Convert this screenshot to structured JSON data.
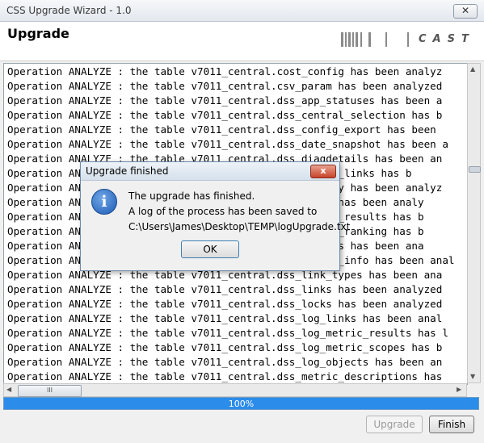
{
  "window": {
    "title": "CSS Upgrade Wizard - 1.0",
    "close_glyph": "✕"
  },
  "header": {
    "heading": "Upgrade",
    "logo_text": "CAST"
  },
  "log": {
    "lines": [
      "Operation ANALYZE : the table v7011_central.cost_config has been analyz",
      "Operation ANALYZE : the table v7011_central.csv_param has been analyzed",
      "Operation ANALYZE : the table v7011_central.dss_app_statuses has been a",
      "Operation ANALYZE : the table v7011_central.dss_central_selection has b",
      "Operation ANALYZE : the table v7011_central.dss_config_export has been",
      "Operation ANALYZE : the table v7011_central.dss_date_snapshot has been a",
      "Operation ANALYZE : the table v7011_central.dss_diagdetails has been an",
      "Operation ANALYZE : the table v7011_central.dss_module_links has b",
      "Operation ANALYZE : the table v7011_central.dss_history has been analyz",
      "Operation ANALYZE : the table v7011_central.dss_links has been analy",
      "Operation ANALYZE : the table v7011_central.dss_metric_results has b",
      "Operation ANALYZE : the table v7011_central.dss_object_ranking has b",
      "Operation ANALYZE : the table v7011_central.dss_objects has been ana",
      "Operation ANALYZE : the table v7011_central.dss_object_info has been anal",
      "Operation ANALYZE : the table v7011_central.dss_link_types has been ana",
      "Operation ANALYZE : the table v7011_central.dss_links has been analyzed",
      "Operation ANALYZE : the table v7011_central.dss_locks has been analyzed",
      "Operation ANALYZE : the table v7011_central.dss_log_links has been anal",
      "Operation ANALYZE : the table v7011_central.dss_log_metric_results has l",
      "Operation ANALYZE : the table v7011_central.dss_log_metric_scopes has b",
      "Operation ANALYZE : the table v7011_central.dss_log_objects has been an",
      "Operation ANALYZE : the table v7011_central.dss_metric_descriptions has"
    ]
  },
  "scrollbars": {
    "horizontal_thumb_grip": "III",
    "left_arrow": "◀",
    "right_arrow": "▶",
    "up_arrow": "▲",
    "down_arrow": "▼"
  },
  "progress": {
    "value_percent": 100,
    "label": "100%",
    "color": "#2b8cea"
  },
  "buttons": {
    "upgrade_label": "Upgrade",
    "finish_label": "Finish"
  },
  "dialog": {
    "title": "Upgrade finished",
    "close_glyph": "x",
    "info_glyph": "i",
    "message_line1": "The upgrade has finished.",
    "message_line2": "A log of the process has been saved to",
    "message_line3": "C:\\Users\\James\\Desktop\\TEMP\\logUpgrade.txt",
    "ok_label": "OK"
  }
}
